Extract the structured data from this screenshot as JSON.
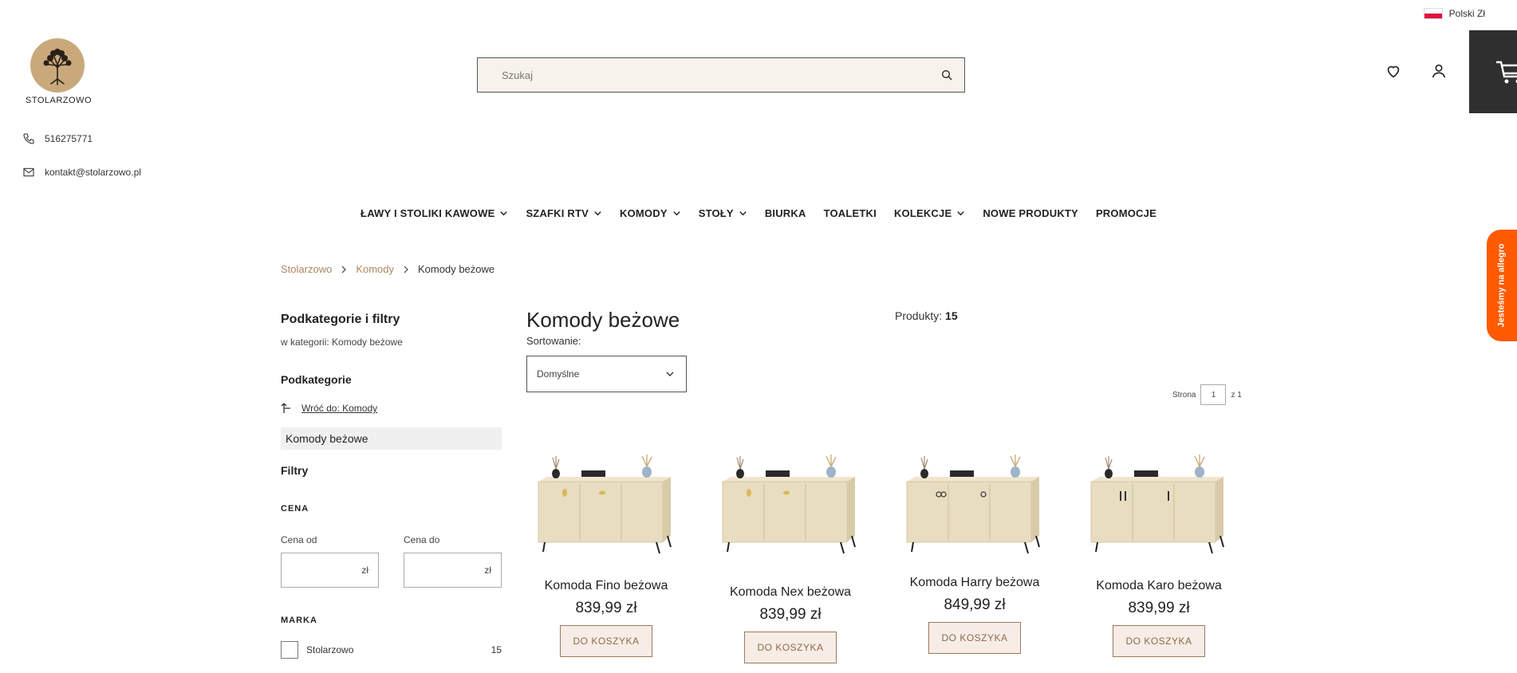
{
  "header": {
    "currency_label": "Polski Zł",
    "logo_text": "STOLARZOWO",
    "phone": "516275771",
    "email": "kontakt@stolarzowo.pl",
    "search_placeholder": "Szukaj"
  },
  "nav": [
    {
      "label": "ŁAWY I STOLIKI KAWOWE",
      "dropdown": true
    },
    {
      "label": "SZAFKI RTV",
      "dropdown": true
    },
    {
      "label": "KOMODY",
      "dropdown": true
    },
    {
      "label": "STOŁY",
      "dropdown": true
    },
    {
      "label": "BIURKA",
      "dropdown": false
    },
    {
      "label": "TOALETKI",
      "dropdown": false
    },
    {
      "label": "KOLEKCJE",
      "dropdown": true
    },
    {
      "label": "NOWE PRODUKTY",
      "dropdown": false
    },
    {
      "label": "PROMOCJE",
      "dropdown": false
    }
  ],
  "breadcrumb": {
    "home": "Stolarzowo",
    "parent": "Komody",
    "current": "Komody beżowe"
  },
  "sidebar": {
    "title": "Podkategorie i filtry",
    "subtitle": "w kategorii: Komody beżowe",
    "subcategories_heading": "Podkategorie",
    "back_link": "Wróć do: Komody",
    "active_category": "Komody beżowe",
    "filters_heading": "Filtry",
    "price_label": "CENA",
    "price_from_label": "Cena od",
    "price_to_label": "Cena do",
    "currency_suffix": "zł",
    "brand_label": "MARKA",
    "brand_option": "Stolarzowo",
    "brand_count": "15"
  },
  "main": {
    "title": "Komody beżowe",
    "count_label": "Produkty:",
    "count_value": "15",
    "sort_label": "Sortowanie:",
    "sort_value": "Domyślne",
    "page_label": "Strona",
    "page_value": "1",
    "page_total": "z 1"
  },
  "products": [
    {
      "name": "Komoda Fino beżowa",
      "price": "839,99 zł",
      "button": "DO KOSZYKA",
      "handle": "gold-round"
    },
    {
      "name": "Komoda Nex beżowa",
      "price": "839,99 zł",
      "button": "DO KOSZYKA",
      "handle": "gold-round"
    },
    {
      "name": "Komoda Harry beżowa",
      "price": "849,99 zł",
      "button": "DO KOSZYKA",
      "handle": "ring"
    },
    {
      "name": "Komoda Karo beżowa",
      "price": "839,99 zł",
      "button": "DO KOSZYKA",
      "handle": "bar"
    }
  ],
  "allegro_label": "Jesteśmy na allegro",
  "colors": {
    "accent": "#a98863",
    "button_bg": "#f7ede6",
    "allegro": "#ff5a00",
    "cart_bg": "#2f2f2f"
  }
}
